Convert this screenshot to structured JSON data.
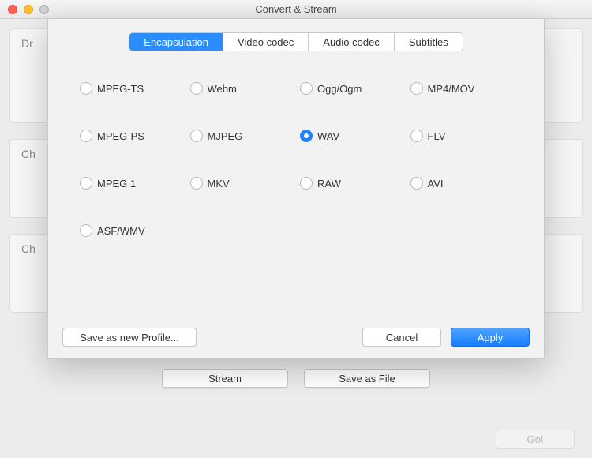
{
  "window": {
    "title": "Convert & Stream"
  },
  "bg": {
    "panel1": "Dr",
    "panel2": "Ch",
    "panel3": "Ch",
    "stream": "Stream",
    "save_as_file": "Save as File",
    "go": "Go!"
  },
  "tabs": {
    "encapsulation": "Encapsulation",
    "video_codec": "Video codec",
    "audio_codec": "Audio codec",
    "subtitles": "Subtitles",
    "active": "encapsulation"
  },
  "formats": [
    {
      "id": "mpeg-ts",
      "label": "MPEG-TS"
    },
    {
      "id": "webm",
      "label": "Webm"
    },
    {
      "id": "ogg",
      "label": "Ogg/Ogm"
    },
    {
      "id": "mp4",
      "label": "MP4/MOV"
    },
    {
      "id": "mpeg-ps",
      "label": "MPEG-PS"
    },
    {
      "id": "mjpeg",
      "label": "MJPEG"
    },
    {
      "id": "wav",
      "label": "WAV"
    },
    {
      "id": "flv",
      "label": "FLV"
    },
    {
      "id": "mpeg1",
      "label": "MPEG 1"
    },
    {
      "id": "mkv",
      "label": "MKV"
    },
    {
      "id": "raw",
      "label": "RAW"
    },
    {
      "id": "avi",
      "label": "AVI"
    },
    {
      "id": "asf",
      "label": "ASF/WMV"
    }
  ],
  "selected_format": "wav",
  "footer": {
    "save_profile": "Save as new Profile...",
    "cancel": "Cancel",
    "apply": "Apply"
  }
}
